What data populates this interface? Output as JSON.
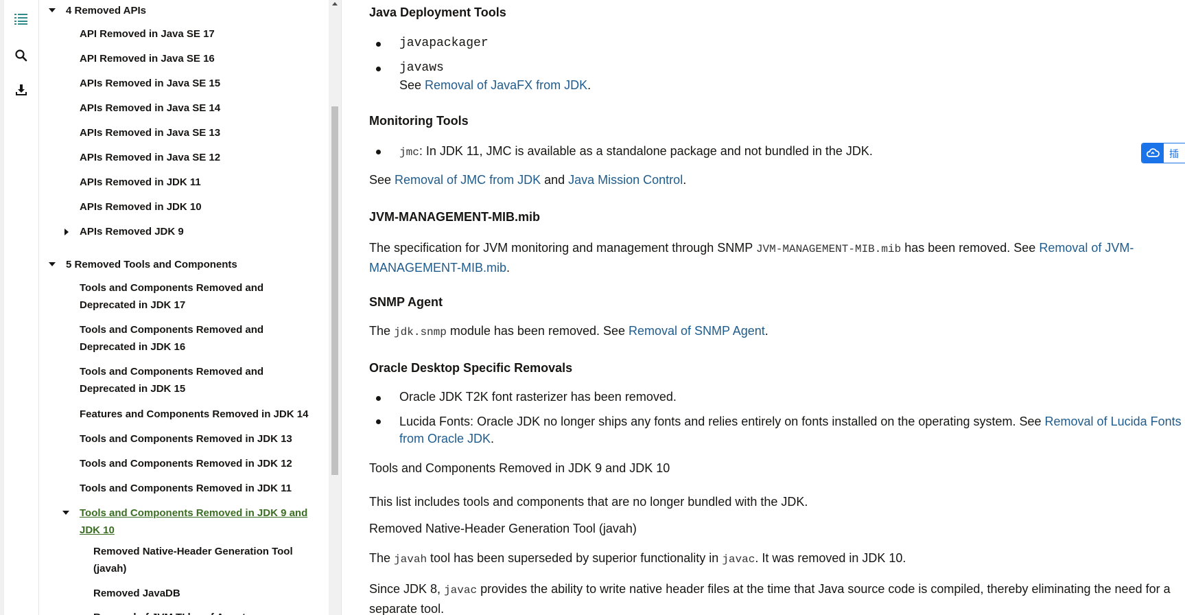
{
  "rail": {
    "icons": [
      "toc-icon",
      "search-icon",
      "download-icon"
    ],
    "accent": "#2f8a8a"
  },
  "toc": {
    "items": [
      {
        "label": "4 Removed APIs"
      },
      {
        "label": "API Removed in Java SE 17"
      },
      {
        "label": "API Removed in Java SE 16"
      },
      {
        "label": "APIs Removed in Java SE 15"
      },
      {
        "label": "APIs Removed in Java SE 14"
      },
      {
        "label": "APIs Removed in Java SE 13"
      },
      {
        "label": "APIs Removed in Java SE 12"
      },
      {
        "label": "APIs Removed in JDK 11"
      },
      {
        "label": "APIs Removed in JDK 10"
      },
      {
        "label": "APIs Removed JDK 9"
      },
      {
        "label": "5 Removed Tools and Components"
      },
      {
        "line1": "Tools and Components Removed and",
        "line2": "Deprecated in JDK 17"
      },
      {
        "line1": "Tools and Components Removed and",
        "line2": "Deprecated in JDK 16"
      },
      {
        "line1": "Tools and Components Removed and",
        "line2": "Deprecated in JDK 15"
      },
      {
        "label": "Features and Components Removed in JDK 14"
      },
      {
        "label": "Tools and Components Removed in JDK 13"
      },
      {
        "label": "Tools and Components Removed in JDK 12"
      },
      {
        "label": "Tools and Components Removed in JDK 11"
      },
      {
        "line1": "Tools and Components Removed in JDK 9 and",
        "line2": "JDK 10",
        "active": true
      },
      {
        "line1": "Removed Native-Header Generation Tool",
        "line2": "(javah)"
      },
      {
        "label": "Removed JavaDB"
      },
      {
        "label": "Removal of JVM TI hprof Agent"
      }
    ],
    "active_color": "#3b6e22"
  },
  "content": {
    "deploy": {
      "heading": "Java Deployment Tools",
      "item1": "javapackager",
      "item2": "javaws",
      "see_prefix": "See ",
      "see_link": "Removal of JavaFX from JDK",
      "see_suffix": "."
    },
    "monitoring": {
      "heading": "Monitoring Tools",
      "code": "jmc",
      "text": ": In JDK 11, JMC is available as a standalone package and not bundled in the JDK.",
      "see_prefix": "See ",
      "link1": "Removal of JMC from JDK",
      "and": " and ",
      "link2": "Java Mission Control",
      "suffix": "."
    },
    "jvmmib": {
      "heading": "JVM-MANAGEMENT-MIB.mib",
      "text1": "The specification for JVM monitoring and management through SNMP ",
      "code": "JVM-MANAGEMENT-MIB.mib",
      "text2": " has been removed. See ",
      "link_part1": "Removal of JVM-",
      "link_part2": "MANAGEMENT-MIB.mib",
      "suffix": "."
    },
    "snmp": {
      "heading": "SNMP Agent",
      "text1": "The ",
      "code": "jdk.snmp",
      "text2": " module has been removed. See ",
      "link": "Removal of SNMP Agent",
      "suffix": "."
    },
    "desktop": {
      "heading": "Oracle Desktop Specific Removals",
      "item1": "Oracle JDK T2K font rasterizer has been removed.",
      "item2_text": "Lucida Fonts: Oracle JDK no longer ships any fonts and relies entirely on fonts installed on the operating system. See ",
      "item2_link1": "Removal of Lucida Fonts",
      "item2_link2": "from Oracle JDK",
      "item2_suffix": "."
    },
    "jdk910": {
      "heading": "Tools and Components Removed in JDK 9 and JDK 10",
      "intro": "This list includes tools and components that are no longer bundled with the JDK."
    },
    "javah": {
      "heading": "Removed Native-Header Generation Tool (javah)",
      "p1_a": "The ",
      "p1_code1": "javah",
      "p1_b": " tool has been superseded by superior functionality in ",
      "p1_code2": "javac",
      "p1_c": ". It was removed in JDK 10.",
      "p2_a": "Since JDK 8, ",
      "p2_code": "javac",
      "p2_b": " provides the ability to write native header files at the time that Java source code is compiled, thereby eliminating the need for a",
      "p2_c": "separate tool."
    },
    "link_color": "#1f5c8e"
  },
  "float_button": {
    "icon": "cloud-sync-icon",
    "label": "插",
    "color": "#1a73e8"
  }
}
